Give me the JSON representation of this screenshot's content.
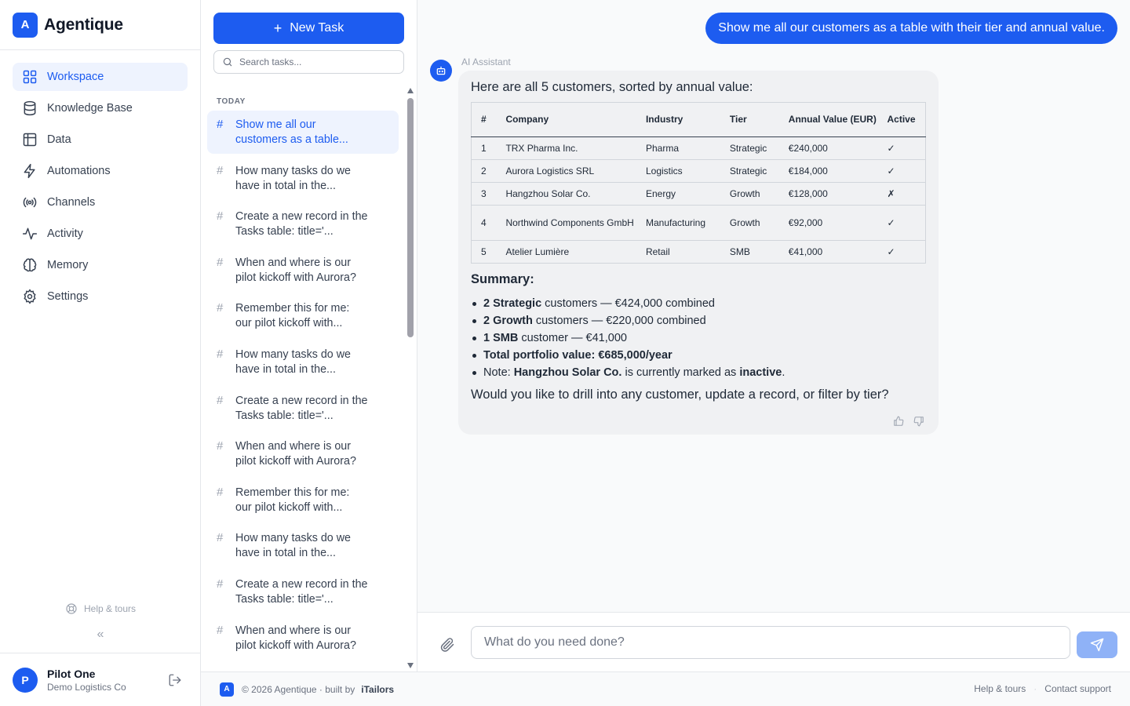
{
  "brand": {
    "logo_letter": "A",
    "name": "Agentique"
  },
  "nav": [
    {
      "label": "Workspace",
      "icon": "grid-icon",
      "active": true
    },
    {
      "label": "Knowledge Base",
      "icon": "database-icon"
    },
    {
      "label": "Data",
      "icon": "table-icon"
    },
    {
      "label": "Automations",
      "icon": "lightning-icon"
    },
    {
      "label": "Channels",
      "icon": "broadcast-icon"
    },
    {
      "label": "Activity",
      "icon": "activity-icon"
    },
    {
      "label": "Memory",
      "icon": "brain-icon"
    },
    {
      "label": "Settings",
      "icon": "gear-icon"
    }
  ],
  "sidebar_footer": {
    "help_label": "Help & tours",
    "collapse_glyph": "«"
  },
  "user": {
    "initial": "P",
    "name": "Pilot One",
    "org": "Demo Logistics Co"
  },
  "tasks_panel": {
    "new_task_label": "New Task",
    "search_placeholder": "Search tasks...",
    "section_label": "TODAY",
    "items": [
      {
        "title": "Show me all our customers as a table...",
        "active": true
      },
      {
        "title": "How many tasks do we have in total in the..."
      },
      {
        "title": "Create a new record in the Tasks table: title='..."
      },
      {
        "title": "When and where is our pilot kickoff with Aurora?"
      },
      {
        "title": "Remember this for me: our pilot kickoff with..."
      },
      {
        "title": "How many tasks do we have in total in the..."
      },
      {
        "title": "Create a new record in the Tasks table: title='..."
      },
      {
        "title": "When and where is our pilot kickoff with Aurora?"
      },
      {
        "title": "Remember this for me: our pilot kickoff with..."
      },
      {
        "title": "How many tasks do we have in total in the..."
      },
      {
        "title": "Create a new record in the Tasks table: title='..."
      },
      {
        "title": "When and where is our pilot kickoff with Aurora?"
      }
    ]
  },
  "chat": {
    "user_message": "Show me all our customers as a table with their tier and annual value.",
    "assistant_label": "AI Assistant",
    "intro": "Here are all 5 customers, sorted by annual value:",
    "table": {
      "headers": [
        "#",
        "Company",
        "Industry",
        "Tier",
        "Annual Value (EUR)",
        "Active"
      ],
      "rows": [
        [
          "1",
          "TRX Pharma Inc.",
          "Pharma",
          "Strategic",
          "€240,000",
          "✓"
        ],
        [
          "2",
          "Aurora Logistics SRL",
          "Logistics",
          "Strategic",
          "€184,000",
          "✓"
        ],
        [
          "3",
          "Hangzhou Solar Co.",
          "Energy",
          "Growth",
          "€128,000",
          "✗"
        ],
        [
          "4",
          "Northwind Components GmbH",
          "Manufacturing",
          "Growth",
          "€92,000",
          "✓"
        ],
        [
          "5",
          "Atelier Lumière",
          "Retail",
          "SMB",
          "€41,000",
          "✓"
        ]
      ]
    },
    "summary_title": "Summary:",
    "summary": [
      {
        "bold": "2 Strategic",
        "text": " customers — €424,000 combined"
      },
      {
        "bold": "2 Growth",
        "text": " customers — €220,000 combined"
      },
      {
        "bold": "1 SMB",
        "text": " customer — €41,000"
      },
      {
        "bold": "Total portfolio value: €685,000/year",
        "text": ""
      },
      {
        "prefix": "Note: ",
        "bold": "Hangzhou Solar Co.",
        "text": " is currently marked as ",
        "bold2": "inactive",
        "suffix": "."
      }
    ],
    "closing": "Would you like to drill into any customer, update a record, or filter by tier?"
  },
  "composer": {
    "placeholder": "What do you need done?"
  },
  "footer": {
    "logo_letter": "A",
    "copyright": "© 2026 Agentique · built by",
    "builder": "iTailors",
    "links": [
      "Help & tours",
      "Contact support"
    ],
    "separator": "·"
  }
}
